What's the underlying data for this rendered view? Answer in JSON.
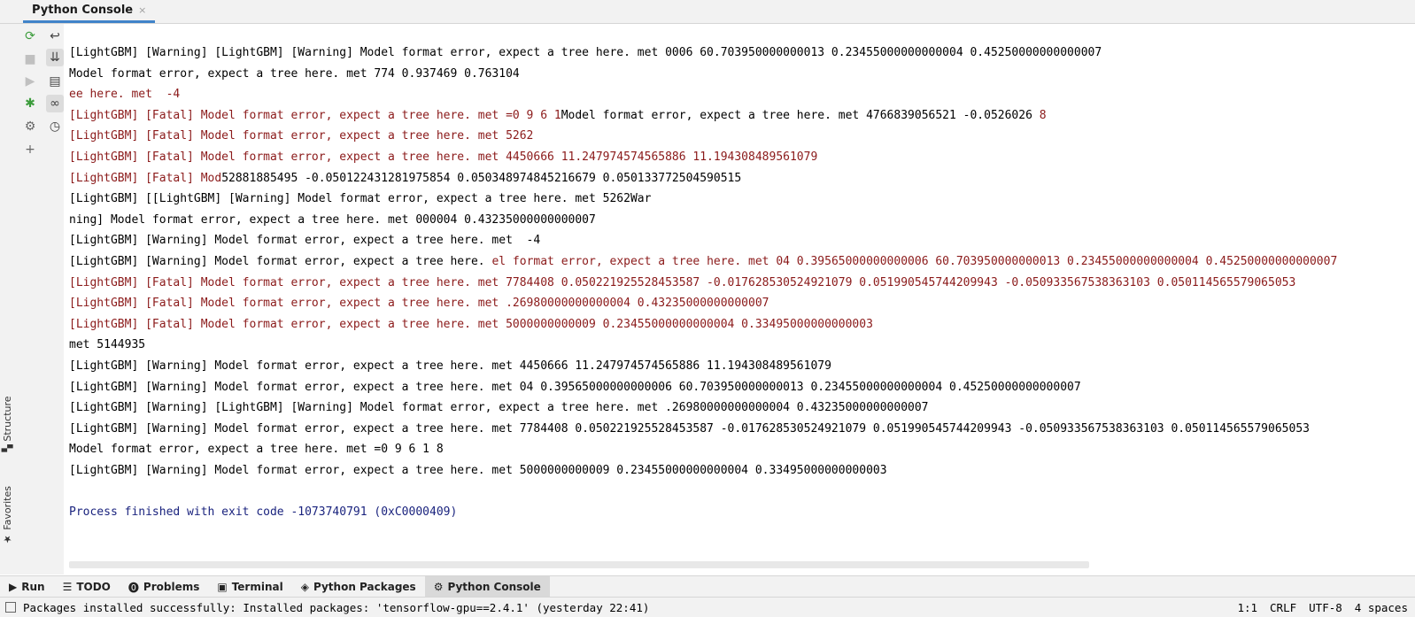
{
  "tab": {
    "title": "Python Console",
    "close": "×"
  },
  "sidebar_labels": {
    "structure": "Structure",
    "favorites": "Favorites"
  },
  "console_lines": [
    {
      "text": "[LightGBM] [Warning] [LightGBM] [Warning] Model format error, expect a tree here. met 0006 60.703950000000013 0.23455000000000004 0.45250000000000007",
      "kind": "normal"
    },
    {
      "text": "Model format error, expect a tree here. met 774 0.937469 0.763104",
      "kind": "normal"
    },
    {
      "text": "ee here. met  -4",
      "kind": "err"
    },
    {
      "text": "[LightGBM] [Fatal] Model format error, expect a tree here. met =0 9 6 1Model format error, expect a tree here. met 4766839056521 -0.0526026 8",
      "kind": "mixed1"
    },
    {
      "text": "[LightGBM] [Fatal] Model format error, expect a tree here. met 5262",
      "kind": "err"
    },
    {
      "text": "[LightGBM] [Fatal] Model format error, expect a tree here. met 4450666 11.247974574565886 11.194308489561079",
      "kind": "err"
    },
    {
      "text": "[LightGBM] [Fatal] Mod52881885495 -0.050122431281975854 0.050348974845216679 0.050133772504590515",
      "kind": "mixed2"
    },
    {
      "text": "[LightGBM] [[LightGBM] [Warning] Model format error, expect a tree here. met 5262War",
      "kind": "normal"
    },
    {
      "text": "ning] Model format error, expect a tree here. met 000004 0.43235000000000007",
      "kind": "normal"
    },
    {
      "text": "[LightGBM] [Warning] Model format error, expect a tree here. met  -4",
      "kind": "normal"
    },
    {
      "text": "[LightGBM] [Warning] Model format error, expect a tree here. el format error, expect a tree here. met 04 0.39565000000000006 60.703950000000013 0.23455000000000004 0.45250000000000007",
      "kind": "mixed3"
    },
    {
      "text": "[LightGBM] [Fatal] Model format error, expect a tree here. met 7784408 0.050221925528453587 -0.017628530524921079 0.051990545744209943 -0.050933567538363103 0.050114565579065053",
      "kind": "err"
    },
    {
      "text": "[LightGBM] [Fatal] Model format error, expect a tree here. met .26980000000000004 0.43235000000000007",
      "kind": "err"
    },
    {
      "text": "[LightGBM] [Fatal] Model format error, expect a tree here. met 5000000000009 0.23455000000000004 0.33495000000000003",
      "kind": "err"
    },
    {
      "text": "met 5144935",
      "kind": "normal"
    },
    {
      "text": "[LightGBM] [Warning] Model format error, expect a tree here. met 4450666 11.247974574565886 11.194308489561079",
      "kind": "normal"
    },
    {
      "text": "[LightGBM] [Warning] Model format error, expect a tree here. met 04 0.39565000000000006 60.703950000000013 0.23455000000000004 0.45250000000000007",
      "kind": "normal"
    },
    {
      "text": "[LightGBM] [Warning] [LightGBM] [Warning] Model format error, expect a tree here. met .26980000000000004 0.43235000000000007",
      "kind": "normal"
    },
    {
      "text": "[LightGBM] [Warning] Model format error, expect a tree here. met 7784408 0.050221925528453587 -0.017628530524921079 0.051990545744209943 -0.050933567538363103 0.050114565579065053",
      "kind": "normal"
    },
    {
      "text": "Model format error, expect a tree here. met =0 9 6 1 8",
      "kind": "normal"
    },
    {
      "text": "[LightGBM] [Warning] Model format error, expect a tree here. met 5000000000009 0.23455000000000004 0.33495000000000003",
      "kind": "normal"
    },
    {
      "text": "",
      "kind": "normal"
    },
    {
      "text": "Process finished with exit code -1073740791 (0xC0000409)",
      "kind": "info"
    }
  ],
  "toolwindows": [
    {
      "label": "Run",
      "icon": "▶",
      "active": false
    },
    {
      "label": "TODO",
      "icon": "☰",
      "active": false
    },
    {
      "label": "Problems",
      "icon": "⓿",
      "active": false
    },
    {
      "label": "Terminal",
      "icon": "▣",
      "active": false
    },
    {
      "label": "Python Packages",
      "icon": "◈",
      "active": false
    },
    {
      "label": "Python Console",
      "icon": "⚙",
      "active": true
    }
  ],
  "status": {
    "message": "Packages installed successfully: Installed packages: 'tensorflow-gpu==2.4.1' (yesterday 22:41)",
    "position": "1:1",
    "line_sep": "CRLF",
    "encoding": "UTF-8",
    "indent": "4 spaces"
  },
  "colors": {
    "error": "#8b1a1a",
    "info": "#1a237e",
    "accent": "#4083c9"
  }
}
